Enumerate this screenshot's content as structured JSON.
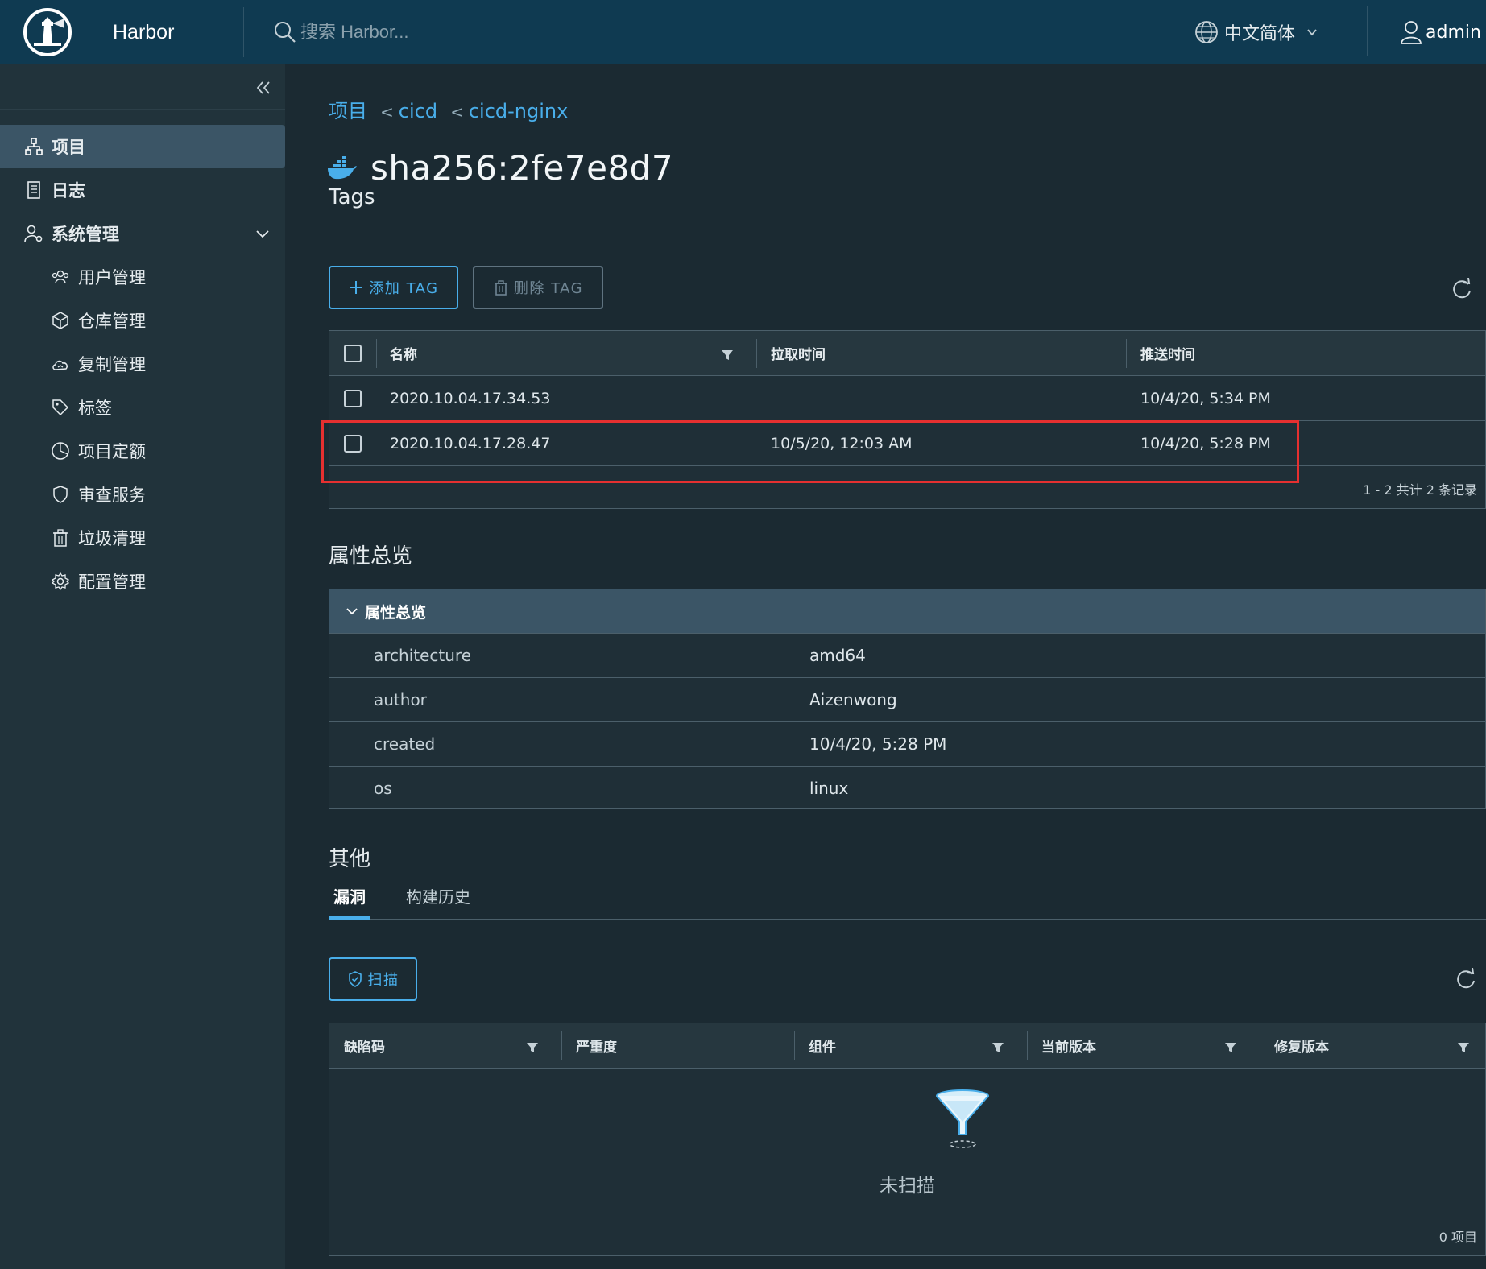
{
  "header": {
    "app_name": "Harbor",
    "search_placeholder": "搜索 Harbor...",
    "language": "中文简体",
    "user": "admin"
  },
  "sidebar": {
    "items": [
      {
        "label": "项目",
        "icon": "projects-icon",
        "active": true
      },
      {
        "label": "日志",
        "icon": "logs-icon"
      },
      {
        "label": "系统管理",
        "icon": "admin-icon",
        "expandable": true
      },
      {
        "label": "用户管理",
        "icon": "users-icon"
      },
      {
        "label": "仓库管理",
        "icon": "registry-icon"
      },
      {
        "label": "复制管理",
        "icon": "cloud-replication-icon"
      },
      {
        "label": "标签",
        "icon": "tag-icon"
      },
      {
        "label": "项目定额",
        "icon": "quota-icon"
      },
      {
        "label": "审查服务",
        "icon": "shield-icon"
      },
      {
        "label": "垃圾清理",
        "icon": "trash-icon"
      },
      {
        "label": "配置管理",
        "icon": "gear-icon"
      }
    ]
  },
  "breadcrumb": [
    "项目",
    "cicd",
    "cicd-nginx"
  ],
  "breadcrumb_sep": "<",
  "artifact": {
    "digest": "sha256:2fe7e8d7"
  },
  "tags_section": {
    "title": "Tags",
    "add_button": "添加 TAG",
    "delete_button": "删除 TAG",
    "columns": [
      "名称",
      "拉取时间",
      "推送时间"
    ],
    "rows": [
      {
        "name": "2020.10.04.17.34.53",
        "pull_time": "",
        "push_time": "10/4/20, 5:34 PM"
      },
      {
        "name": "2020.10.04.17.28.47",
        "pull_time": "10/5/20, 12:03 AM",
        "push_time": "10/4/20, 5:28 PM"
      }
    ],
    "footer": "1 - 2 共计 2 条记录"
  },
  "properties": {
    "section_title": "属性总览",
    "panel_title": "属性总览",
    "rows": [
      {
        "key": "architecture",
        "value": "amd64"
      },
      {
        "key": "author",
        "value": "Aizenwong"
      },
      {
        "key": "created",
        "value": "10/4/20, 5:28 PM"
      },
      {
        "key": "os",
        "value": "linux"
      }
    ]
  },
  "other": {
    "title": "其他",
    "tabs": [
      {
        "label": "漏洞",
        "active": true
      },
      {
        "label": "构建历史",
        "active": false
      }
    ],
    "scan_button": "扫描",
    "vuln_columns": [
      "缺陷码",
      "严重度",
      "组件",
      "当前版本",
      "修复版本"
    ],
    "empty_message": "未扫描",
    "footer": "0 项目"
  },
  "colors": {
    "header_bg": "#0f3a51",
    "sidebar_bg": "#21333b",
    "main_bg": "#1b2a32",
    "accent": "#49aeea",
    "highlight_box": "#e53030"
  }
}
